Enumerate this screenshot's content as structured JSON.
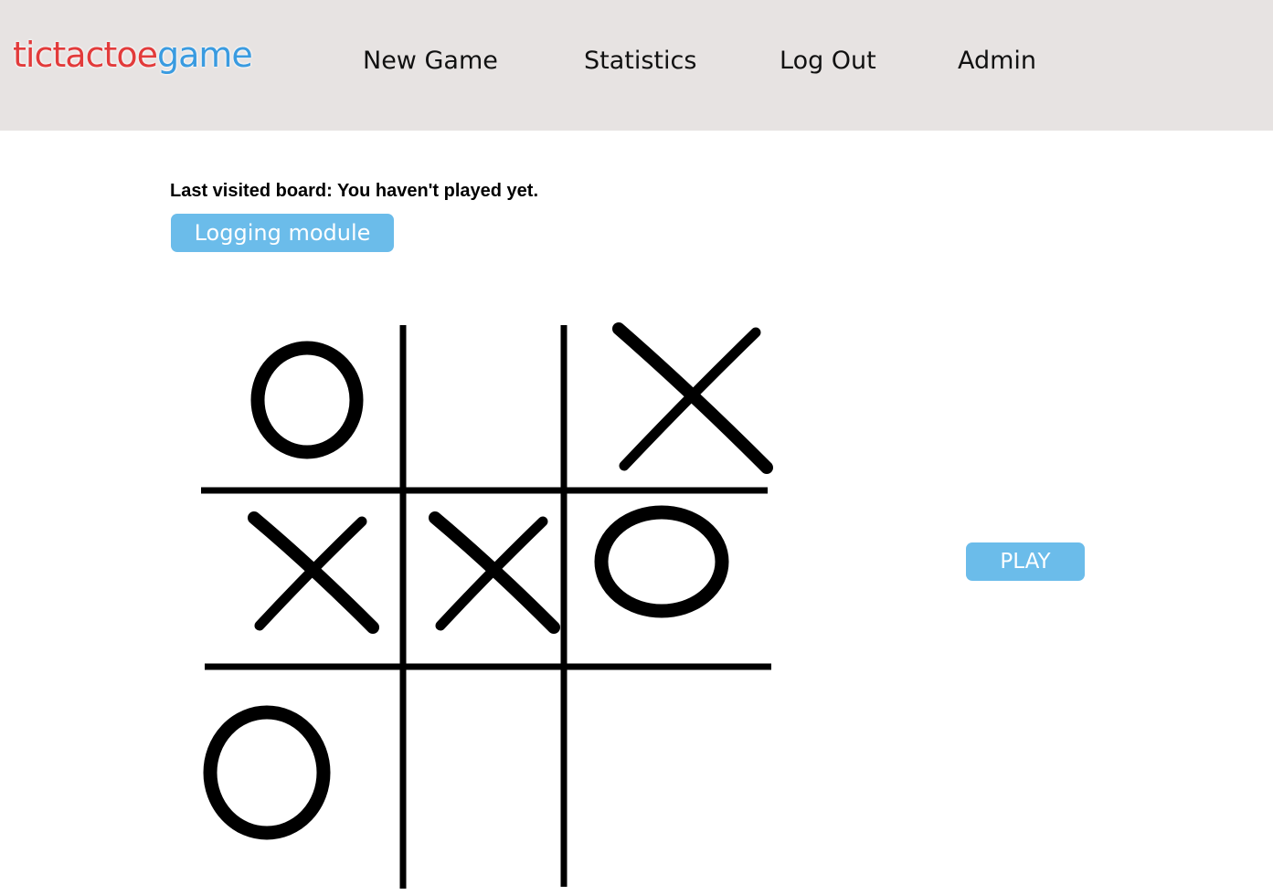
{
  "header": {
    "logo_part1": "tictactoe",
    "logo_part2": "game",
    "nav": [
      "New Game",
      "Statistics",
      "Log Out",
      "Admin"
    ]
  },
  "main": {
    "last_visited": "Last visited board: You haven't played yet.",
    "logging_button": "Logging module",
    "play_button": "PLAY"
  },
  "board": {
    "cells": [
      "O",
      "",
      "X",
      "X",
      "X",
      "O",
      "O",
      "",
      ""
    ]
  },
  "colors": {
    "header_bg": "#e7e3e2",
    "logo_red": "#e23b3b",
    "logo_blue": "#3a9be0",
    "button_bg": "#6bbcea"
  }
}
